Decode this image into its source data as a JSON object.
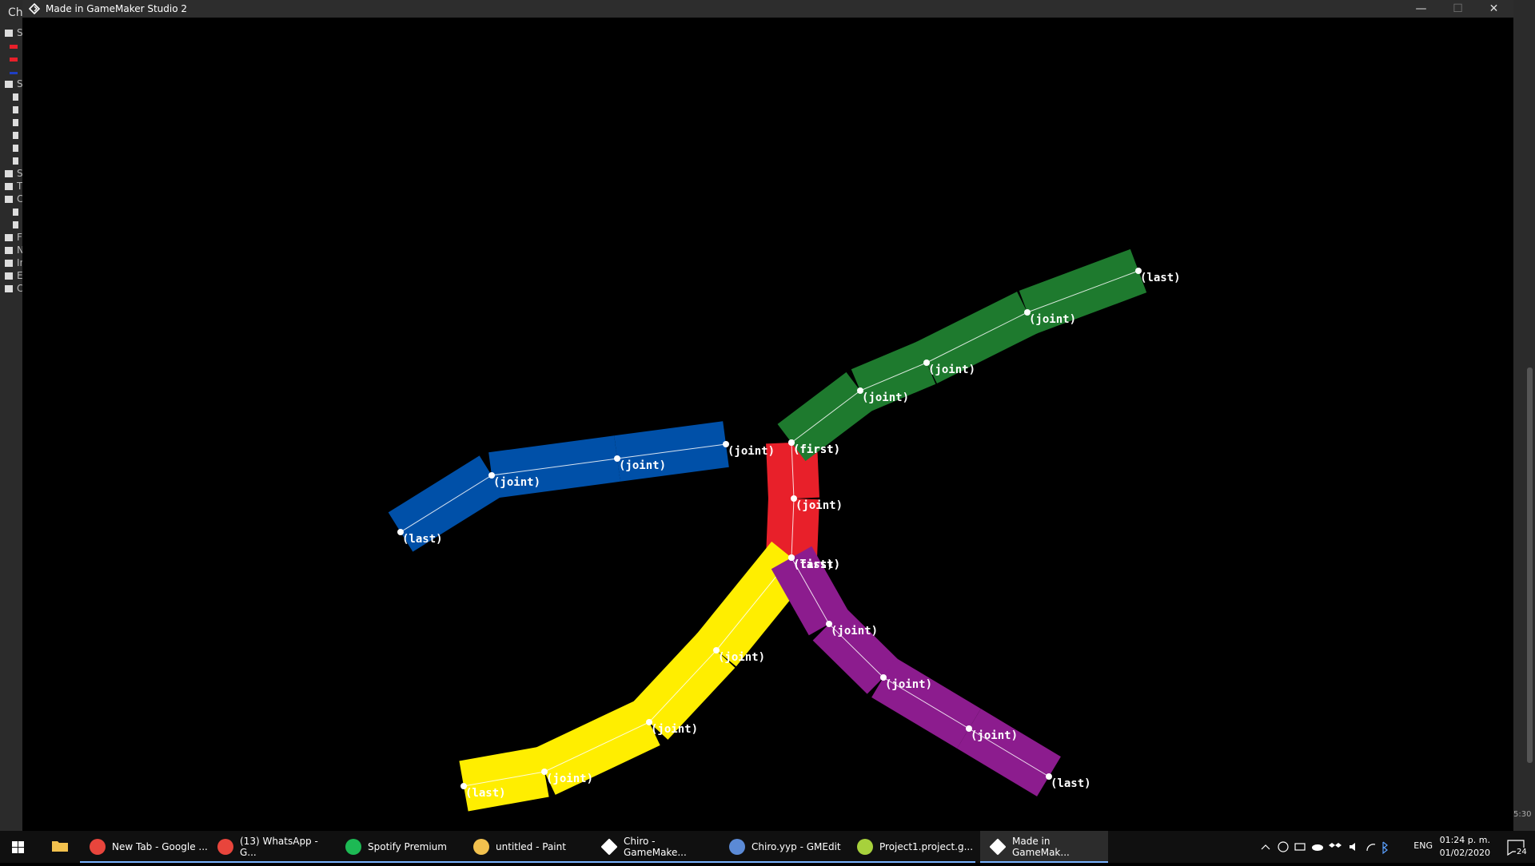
{
  "background_app": {
    "title_fragment": "Ch",
    "tree": [
      {
        "icon": "folder-open-icon",
        "label": "S"
      },
      {
        "icon": "color-swatch-red-icon",
        "label": ""
      },
      {
        "icon": "color-swatch-red-icon",
        "label": ""
      },
      {
        "icon": "color-swatch-blue-icon",
        "label": ""
      },
      {
        "icon": "folder-open-icon",
        "label": "S"
      },
      {
        "icon": "file-icon",
        "label": ""
      },
      {
        "icon": "file-icon",
        "label": ""
      },
      {
        "icon": "file-icon",
        "label": ""
      },
      {
        "icon": "file-icon",
        "label": ""
      },
      {
        "icon": "file-icon",
        "label": ""
      },
      {
        "icon": "file-icon",
        "label": ""
      },
      {
        "icon": "folder-icon",
        "label": "S"
      },
      {
        "icon": "folder-icon",
        "label": "T"
      },
      {
        "icon": "folder-open-icon",
        "label": "C"
      },
      {
        "icon": "file-icon",
        "label": ""
      },
      {
        "icon": "file-icon",
        "label": ""
      },
      {
        "icon": "folder-icon",
        "label": "F"
      },
      {
        "icon": "folder-icon",
        "label": "N"
      },
      {
        "icon": "folder-icon",
        "label": "In"
      },
      {
        "icon": "folder-icon",
        "label": "E"
      },
      {
        "icon": "folder-icon",
        "label": "C"
      }
    ],
    "right_time_fragment": "5:30"
  },
  "window": {
    "title": "Made in GameMaker Studio 2",
    "minimize": "—",
    "maximize": "☐",
    "close": "✕"
  },
  "skeleton": {
    "limbs": [
      {
        "name": "torso",
        "color": "#e8202a",
        "joints": [
          {
            "label": "(first)"
          },
          {
            "label": "(joint)"
          },
          {
            "label": "(last)"
          }
        ]
      },
      {
        "name": "right-arm",
        "color": "#1e7a2e",
        "joints": [
          {
            "label": "(first)"
          },
          {
            "label": "(joint)"
          },
          {
            "label": "(joint)"
          },
          {
            "label": "(joint)"
          },
          {
            "label": "(last)"
          }
        ]
      },
      {
        "name": "left-arm",
        "color": "#0050a8",
        "joints": [
          {
            "label": "(joint)"
          },
          {
            "label": "(joint)"
          },
          {
            "label": "(joint)"
          },
          {
            "label": "(last)"
          }
        ]
      },
      {
        "name": "left-leg",
        "color": "#ffee00",
        "joints": [
          {
            "label": "(first)"
          },
          {
            "label": "(joint)"
          },
          {
            "label": "(joint)"
          },
          {
            "label": "(joint)"
          },
          {
            "label": "(last)"
          }
        ]
      },
      {
        "name": "right-leg",
        "color": "#8c1c8e",
        "joints": [
          {
            "label": "(first)"
          },
          {
            "label": "(joint)"
          },
          {
            "label": "(joint)"
          },
          {
            "label": "(joint)"
          },
          {
            "label": "(last)"
          }
        ]
      }
    ]
  },
  "taskbar": {
    "items": [
      {
        "label": "New Tab - Google ...",
        "icon": "chrome-icon",
        "color": "#e8453c"
      },
      {
        "label": "(13) WhatsApp - G...",
        "icon": "chrome-icon",
        "color": "#e8453c"
      },
      {
        "label": "Spotify Premium",
        "icon": "spotify-icon",
        "color": "#1db954"
      },
      {
        "label": "untitled - Paint",
        "icon": "paint-icon",
        "color": "#f2c14e"
      },
      {
        "label": "Chiro - GameMake...",
        "icon": "gamemaker-icon",
        "color": "#ffffff"
      },
      {
        "label": "Chiro.yyp - GMEdit",
        "icon": "gmedit-icon",
        "color": "#5b8ad6"
      },
      {
        "label": "Project1.project.g...",
        "icon": "project-icon",
        "color": "#a7d13c"
      },
      {
        "label": "Made in GameMak...",
        "icon": "gamemaker-icon",
        "color": "#ffffff",
        "active": true
      }
    ],
    "language": "ENG",
    "time": "01:24 p. m.",
    "date": "01/02/2020",
    "notifications": "24"
  }
}
